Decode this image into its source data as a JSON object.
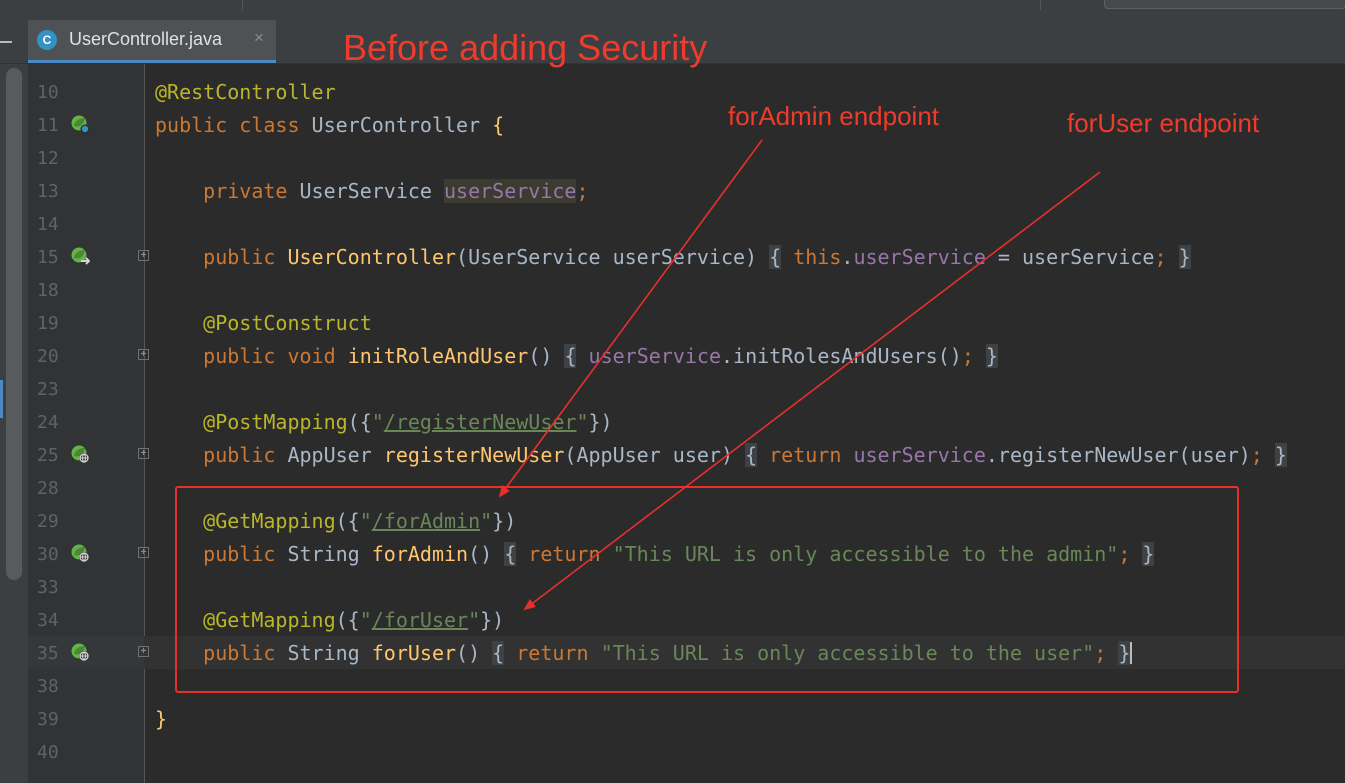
{
  "window": {
    "tab": {
      "label": "UserController.java",
      "icon_letter": "C",
      "close_glyph": "×"
    }
  },
  "annotations": {
    "title": "Before adding Security",
    "arrow_admin_label": "forAdmin endpoint",
    "arrow_user_label": "forUser endpoint",
    "color": "#e8302a"
  },
  "editor": {
    "lines": [
      {
        "n": "10",
        "t": [
          "@RestController"
        ]
      },
      {
        "n": "11",
        "t": [
          "public",
          " ",
          "class",
          " UserController ",
          "{"
        ]
      },
      {
        "n": "12",
        "t": []
      },
      {
        "n": "13",
        "t": [
          "    ",
          "private",
          " UserService ",
          "userService",
          ";"
        ]
      },
      {
        "n": "14",
        "t": []
      },
      {
        "n": "15",
        "t": [
          "    ",
          "public",
          " ",
          "UserController",
          "(UserService userService) ",
          "{",
          " ",
          "this",
          ".",
          "userService",
          " = userService",
          ";",
          " ",
          "}"
        ]
      },
      {
        "n": "18",
        "t": []
      },
      {
        "n": "19",
        "t": [
          "    ",
          "@PostConstruct"
        ]
      },
      {
        "n": "20",
        "t": [
          "    ",
          "public",
          " ",
          "void",
          " ",
          "initRoleAndUser",
          "() ",
          "{",
          " ",
          "userService",
          ".initRolesAndUsers()",
          ";",
          " ",
          "}"
        ]
      },
      {
        "n": "23",
        "t": []
      },
      {
        "n": "24",
        "t": [
          "    ",
          "@PostMapping",
          "({",
          "\"",
          "/registerNewUser",
          "\"",
          "})"
        ]
      },
      {
        "n": "25",
        "t": [
          "    ",
          "public",
          " AppUser ",
          "registerNewUser",
          "(AppUser user) ",
          "{",
          " ",
          "return",
          " ",
          "userService",
          ".registerNewUser(user)",
          ";",
          " ",
          "}"
        ]
      },
      {
        "n": "28",
        "t": []
      },
      {
        "n": "29",
        "t": [
          "    ",
          "@GetMapping",
          "({",
          "\"",
          "/forAdmin",
          "\"",
          "})"
        ]
      },
      {
        "n": "30",
        "t": [
          "    ",
          "public",
          " String ",
          "forAdmin",
          "() ",
          "{",
          " ",
          "return",
          " ",
          "\"This URL is only accessible to the admin\"",
          ";",
          " ",
          "}"
        ]
      },
      {
        "n": "33",
        "t": []
      },
      {
        "n": "34",
        "t": [
          "    ",
          "@GetMapping",
          "({",
          "\"",
          "/forUser",
          "\"",
          "})"
        ]
      },
      {
        "n": "35",
        "t": [
          "    ",
          "public",
          " String ",
          "forUser",
          "() ",
          "{",
          " ",
          "return",
          " ",
          "\"This URL is only accessible to the user\"",
          ";",
          " ",
          "}"
        ]
      },
      {
        "n": "38",
        "t": []
      },
      {
        "n": "39",
        "t": [
          "}"
        ]
      },
      {
        "n": "40",
        "t": []
      }
    ]
  }
}
